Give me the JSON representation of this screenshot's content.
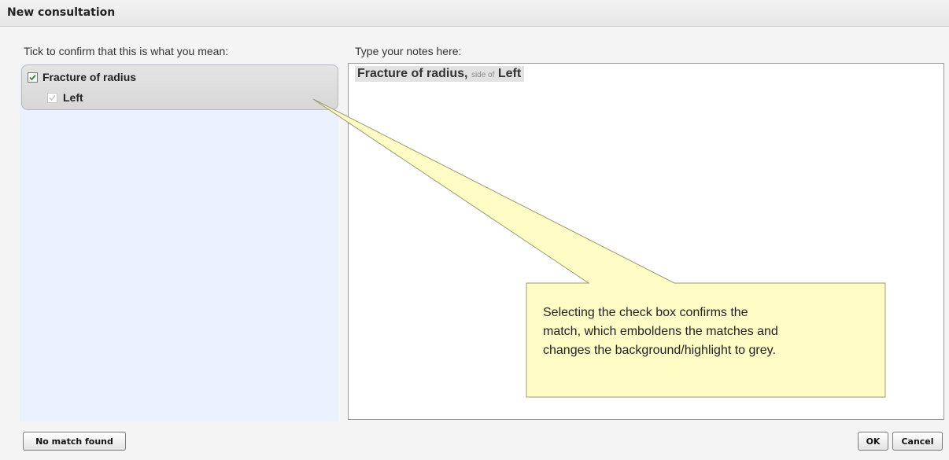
{
  "dialog": {
    "title": "New consultation"
  },
  "matches": {
    "label": "Tick to confirm that this is what you mean:",
    "items": [
      {
        "label": "Fracture of radius",
        "checked": true
      },
      {
        "label": "Left",
        "checked": true
      }
    ]
  },
  "notes": {
    "label": "Type your notes here:",
    "text_main": "Fracture of radius",
    "text_comma": ",",
    "text_qualifier": "side of",
    "text_value": "Left"
  },
  "callout": {
    "lines": [
      "Selecting the check box confirms the",
      "match, which emboldens the matches and",
      "changes the background/highlight to grey."
    ]
  },
  "buttons": {
    "no_match": "No match found",
    "ok": "OK",
    "cancel": "Cancel"
  },
  "colors": {
    "match_panel_bg": "#eaf1fd",
    "selected_match_bg": "#d9d9d9",
    "callout_bg": "#fffcc6",
    "check_green": "#2e8b2e"
  }
}
